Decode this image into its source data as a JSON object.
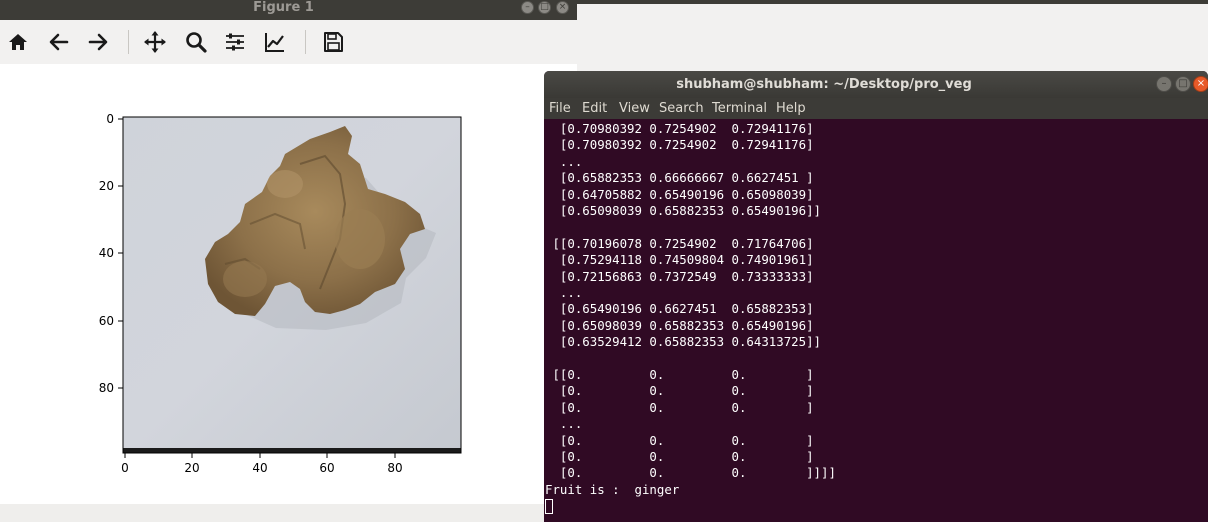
{
  "figure_window": {
    "title": "Figure 1",
    "controls": {
      "minimize": "–",
      "maximize": "□",
      "close": "×"
    },
    "toolbar": {
      "buttons": [
        "home-icon",
        "back-arrow-icon",
        "forward-arrow-icon",
        "pan-icon",
        "zoom-icon",
        "configure-subplots-icon",
        "edit-axes-icon",
        "save-icon"
      ]
    },
    "plot": {
      "type": "image",
      "x_ticks": [
        "0",
        "20",
        "40",
        "60",
        "80"
      ],
      "y_ticks": [
        "0",
        "20",
        "40",
        "60",
        "80"
      ],
      "image_subject": "ginger root on light grey background"
    }
  },
  "terminal_window": {
    "title": "shubham@shubham: ~/Desktop/pro_veg",
    "controls": {
      "minimize": "–",
      "maximize": "□",
      "close": "×"
    },
    "menu": [
      "File",
      "Edit",
      "View",
      "Search",
      "Terminal",
      "Help"
    ],
    "lines": [
      "  [0.70980392 0.7254902  0.72941176]",
      "  [0.70980392 0.7254902  0.72941176]",
      "  ...",
      "  [0.65882353 0.66666667 0.6627451 ]",
      "  [0.64705882 0.65490196 0.65098039]",
      "  [0.65098039 0.65882353 0.65490196]]",
      "",
      " [[0.70196078 0.7254902  0.71764706]",
      "  [0.75294118 0.74509804 0.74901961]",
      "  [0.72156863 0.7372549  0.73333333]",
      "  ...",
      "  [0.65490196 0.6627451  0.65882353]",
      "  [0.65098039 0.65882353 0.65490196]",
      "  [0.63529412 0.65882353 0.64313725]]",
      "",
      " [[0.         0.         0.        ]",
      "  [0.         0.         0.        ]",
      "  [0.         0.         0.        ]",
      "  ...",
      "  [0.         0.         0.        ]",
      "  [0.         0.         0.        ]",
      "  [0.         0.         0.        ]]]]",
      "Fruit is :  ginger"
    ]
  }
}
